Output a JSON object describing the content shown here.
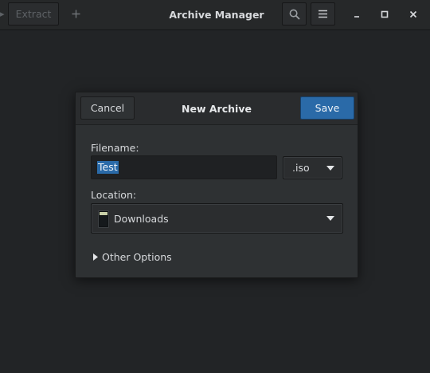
{
  "window": {
    "title": "Archive Manager"
  },
  "headerbar": {
    "extract_label": "Extract",
    "add_icon": "plus-icon",
    "search_icon": "search-icon",
    "menu_icon": "hamburger-menu-icon",
    "window_controls": [
      "minimize-icon",
      "maximize-icon",
      "close-icon"
    ]
  },
  "dialog": {
    "title": "New Archive",
    "cancel_label": "Cancel",
    "save_label": "Save",
    "filename_label": "Filename:",
    "filename_value": "Test",
    "extension_value": ".iso",
    "location_label": "Location:",
    "location_value": "Downloads",
    "location_icon": "folder-downloads-icon",
    "other_options_label": "Other Options"
  },
  "colors": {
    "accent": "#2a6aa8",
    "background": "#222426",
    "dialog_bg": "#2e3133",
    "text": "#d7d9dc"
  }
}
